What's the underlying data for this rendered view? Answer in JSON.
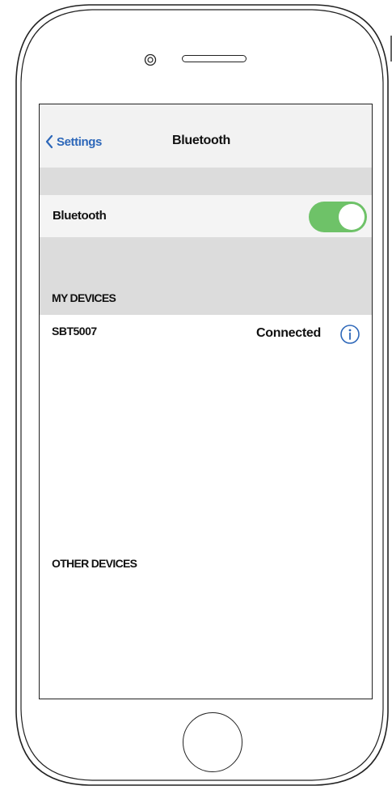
{
  "nav": {
    "back_label": "Settings",
    "title": "Bluetooth",
    "accent_color": "#2d67b9"
  },
  "bluetooth_row": {
    "label": "Bluetooth",
    "toggle_on": true,
    "toggle_color": "#6ec268"
  },
  "sections": {
    "my_devices": "MY DEVICES",
    "other_devices": "OTHER DEVICES"
  },
  "devices": [
    {
      "name": "SBT5007",
      "status": "Connected",
      "icon": "info-icon"
    }
  ],
  "icons": [
    "back-chevron-icon",
    "info-icon",
    "camera-icon",
    "speaker-grille",
    "home-button"
  ]
}
